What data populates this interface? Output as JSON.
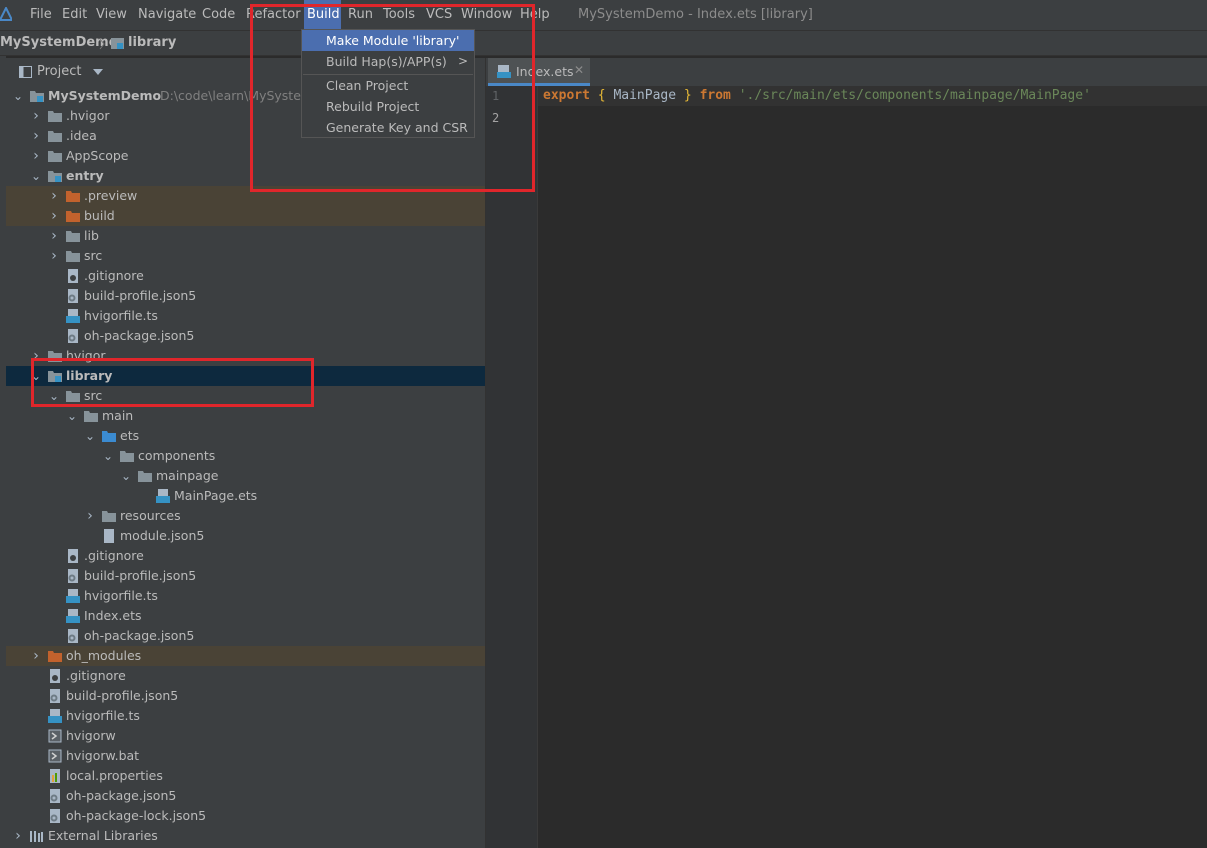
{
  "menubar": {
    "items": [
      "File",
      "Edit",
      "View",
      "Navigate",
      "Code",
      "Refactor",
      "Build",
      "Run",
      "Tools",
      "VCS",
      "Window",
      "Help"
    ],
    "window_title": "MySystemDemo - Index.ets [library]"
  },
  "breadcrumb": [
    "MySystemDemo",
    "library"
  ],
  "project_panel": {
    "title": "Project"
  },
  "tree": [
    {
      "label": "MySystemDemo",
      "path": "D:\\code\\learn\\MySystemD",
      "icon": "module",
      "expanded": true,
      "bold": true
    },
    {
      "label": ".hvigor",
      "icon": "folder",
      "expanded": false
    },
    {
      "label": ".idea",
      "icon": "folder",
      "expanded": false
    },
    {
      "label": "AppScope",
      "icon": "folder",
      "expanded": false
    },
    {
      "label": "entry",
      "icon": "module",
      "expanded": true,
      "bold": true
    },
    {
      "label": ".preview",
      "icon": "folder-excluded",
      "expanded": false
    },
    {
      "label": "build",
      "icon": "folder-excluded",
      "expanded": false
    },
    {
      "label": "lib",
      "icon": "folder",
      "expanded": false
    },
    {
      "label": "src",
      "icon": "folder",
      "expanded": false
    },
    {
      "label": ".gitignore",
      "icon": "file-ignore"
    },
    {
      "label": "build-profile.json5",
      "icon": "file-config"
    },
    {
      "label": "hvigorfile.ts",
      "icon": "file-ts"
    },
    {
      "label": "oh-package.json5",
      "icon": "file-config"
    },
    {
      "label": "hvigor",
      "icon": "folder",
      "expanded": false
    },
    {
      "label": "library",
      "icon": "module",
      "expanded": true,
      "bold": true
    },
    {
      "label": "src",
      "icon": "folder",
      "expanded": true
    },
    {
      "label": "main",
      "icon": "folder",
      "expanded": true
    },
    {
      "label": "ets",
      "icon": "folder-source",
      "expanded": true
    },
    {
      "label": "components",
      "icon": "folder",
      "expanded": true
    },
    {
      "label": "mainpage",
      "icon": "folder",
      "expanded": true
    },
    {
      "label": "MainPage.ets",
      "icon": "file-ets"
    },
    {
      "label": "resources",
      "icon": "folder",
      "expanded": false
    },
    {
      "label": "module.json5",
      "icon": "file-plain"
    },
    {
      "label": ".gitignore",
      "icon": "file-ignore"
    },
    {
      "label": "build-profile.json5",
      "icon": "file-config"
    },
    {
      "label": "hvigorfile.ts",
      "icon": "file-ts"
    },
    {
      "label": "Index.ets",
      "icon": "file-ets"
    },
    {
      "label": "oh-package.json5",
      "icon": "file-config"
    },
    {
      "label": "oh_modules",
      "icon": "folder-excluded",
      "expanded": false
    },
    {
      "label": ".gitignore",
      "icon": "file-ignore"
    },
    {
      "label": "build-profile.json5",
      "icon": "file-config"
    },
    {
      "label": "hvigorfile.ts",
      "icon": "file-ts"
    },
    {
      "label": "hvigorw",
      "icon": "file-script"
    },
    {
      "label": "hvigorw.bat",
      "icon": "file-script"
    },
    {
      "label": "local.properties",
      "icon": "file-properties"
    },
    {
      "label": "oh-package.json5",
      "icon": "file-config"
    },
    {
      "label": "oh-package-lock.json5",
      "icon": "file-config"
    },
    {
      "label": "External Libraries",
      "icon": "libraries",
      "expanded": false
    }
  ],
  "editor": {
    "tab": {
      "label": "Index.ets"
    },
    "line_numbers": [
      "1",
      "2"
    ],
    "code": {
      "kw1": "export",
      "brace_open": "{",
      "ident": "MainPage",
      "brace_close": "}",
      "kw2": "from",
      "str": "'./src/main/ets/components/mainpage/MainPage'"
    }
  },
  "build_menu": {
    "items": [
      "Make Module 'library'",
      "Build Hap(s)/APP(s)",
      "Clean Project",
      "Rebuild Project",
      "Generate Key and CSR"
    ]
  },
  "colors": {
    "accent": "#4b6eaf",
    "highlight": "#e0262b",
    "selection": "#0d293e",
    "excluded": "#4a4336"
  }
}
